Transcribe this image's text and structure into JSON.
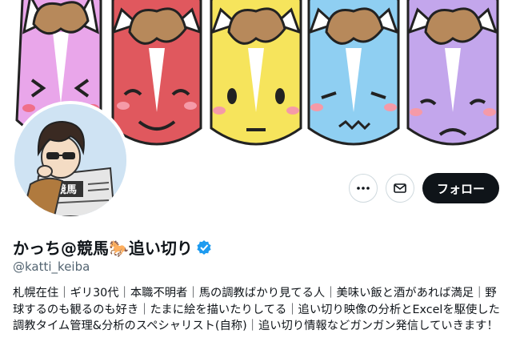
{
  "profile": {
    "display_name": "かっち@競馬🐎追い切り",
    "handle": "@katti_keiba",
    "verified": true,
    "bio": "札幌在住｜ギリ30代｜本職不明者｜馬の調教ばかり見てる人｜美味い飯と酒があれば満足｜野球するのも観るのも好き｜たまに絵を描いたりしてる｜追い切り映像の分析とExcelを駆使した調教タイム管理&分析のスペシャリスト(自称)｜追い切り情報などガンガン発信していきます！",
    "avatar_text": "競馬"
  },
  "actions": {
    "more_icon": "more-horizontal-icon",
    "message_icon": "envelope-icon",
    "follow_label": "フォロー"
  },
  "banner": {
    "horses": [
      {
        "color": "#e9a6ea",
        "face": "squint"
      },
      {
        "color": "#e0585e",
        "face": "smile"
      },
      {
        "color": "#f6e45c",
        "face": "neutral"
      },
      {
        "color": "#8fcff2",
        "face": "worried"
      },
      {
        "color": "#c3a6ec",
        "face": "sad"
      }
    ],
    "mane_color": "#b7895b"
  },
  "colors": {
    "verified": "#1d9bf0",
    "follow_bg": "#0f1419",
    "secondary_text": "#536471"
  }
}
